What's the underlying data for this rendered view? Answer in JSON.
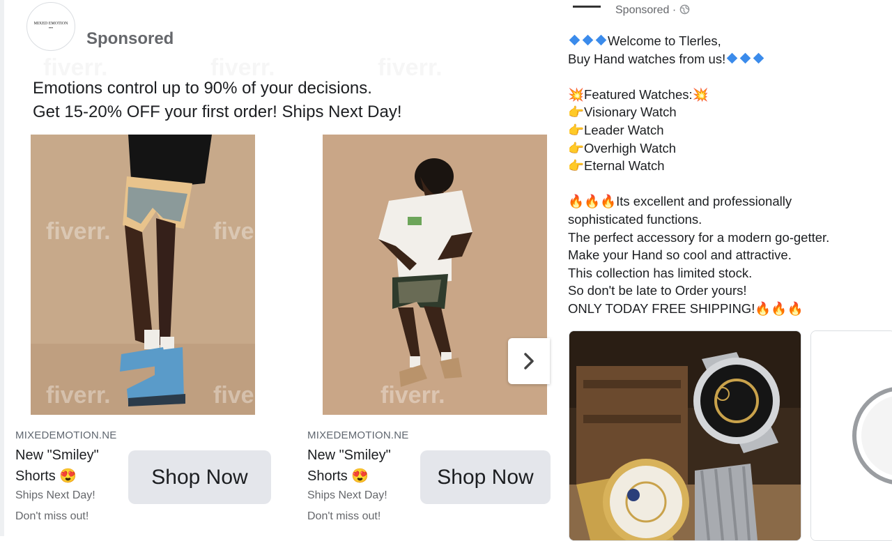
{
  "left_ad": {
    "sponsored_label": "Sponsored",
    "primary_text_line1": "Emotions control up to 90% of your decisions.",
    "primary_text_line2": "Get 15-20% OFF your first order! Ships Next Day!",
    "watermark": "fiverr.",
    "cards": [
      {
        "domain": "MIXEDEMOTION.NE",
        "headline_line1": "New \"Smiley\"",
        "headline_line2": "Shorts 😍",
        "description_line1": "Ships Next Day!",
        "description_line2": "Don't miss out!",
        "cta_label": "Shop Now"
      },
      {
        "domain": "MIXEDEMOTION.NE",
        "headline_line1": "New \"Smiley\"",
        "headline_line2": "Shorts 😍",
        "description_line1": "Ships Next Day!",
        "description_line2": "Don't miss out!",
        "cta_label": "Shop Now"
      }
    ],
    "next_icon": "chevron-right-icon"
  },
  "right_ad": {
    "sponsored_label": "Sponsored · ",
    "privacy_icon": "globe-icon",
    "lines": [
      "Welcome to Tlerles,",
      "Buy Hand watches from us!",
      "",
      "Featured Watches:",
      "Visionary Watch",
      "Leader Watch",
      "Overhigh Watch",
      "Eternal Watch",
      "",
      "Its excellent and professionally",
      "sophisticated functions.",
      "The perfect accessory for a modern go-getter.",
      "Make your Hand so cool and attractive.",
      "This collection has limited stock.",
      "So don't be late to Order yours!",
      "ONLY TODAY FREE SHIPPING!"
    ],
    "emoji": {
      "sparkle": "💥",
      "point": "👉",
      "fire": "🔥"
    }
  },
  "colors": {
    "accent_blue": "#3b8beb",
    "button_gray": "#e4e6eb",
    "meta_gray": "#65676b"
  }
}
